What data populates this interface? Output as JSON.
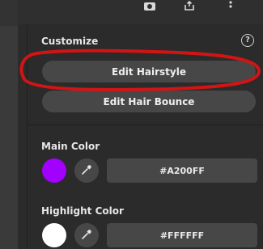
{
  "panel": {
    "section_title": "Customize",
    "help_icon": "question-circle-icon",
    "buttons": {
      "edit_hairstyle": "Edit Hairstyle",
      "edit_hair_bounce": "Edit Hair Bounce"
    }
  },
  "colors": {
    "main": {
      "label": "Main Color",
      "hex": "#A200FF",
      "swatch": "#A200FF"
    },
    "highlight": {
      "label": "Highlight Color",
      "hex": "#FFFFFF",
      "swatch": "#FFFFFF"
    }
  },
  "toolbar": {
    "icons": [
      "camera-icon",
      "share-icon",
      "more-vertical-icon"
    ]
  },
  "annotation_color": "#D21414"
}
